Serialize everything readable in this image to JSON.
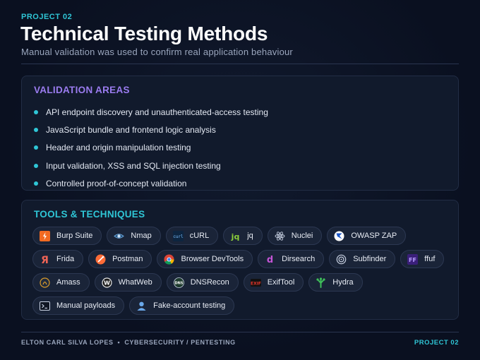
{
  "header": {
    "kicker": "PROJECT 02",
    "title": "Technical Testing Methods",
    "subtitle": "Manual validation was used to confirm real application behaviour"
  },
  "validation": {
    "heading": "VALIDATION AREAS",
    "items": [
      "API endpoint discovery and unauthenticated-access testing",
      "JavaScript bundle and frontend logic analysis",
      "Header and origin manipulation testing",
      "Input validation, XSS and SQL injection testing",
      "Controlled proof-of-concept validation"
    ]
  },
  "tools": {
    "heading": "TOOLS & TECHNIQUES",
    "items": [
      {
        "label": "Burp Suite",
        "icon": "burp-suite-icon"
      },
      {
        "label": "Nmap",
        "icon": "nmap-eye-icon"
      },
      {
        "label": "cURL",
        "icon": "curl-icon"
      },
      {
        "label": "jq",
        "icon": "jq-icon"
      },
      {
        "label": "Nuclei",
        "icon": "nuclei-atom-icon"
      },
      {
        "label": "OWASP ZAP",
        "icon": "owasp-zap-icon"
      },
      {
        "label": "Frida",
        "icon": "frida-icon"
      },
      {
        "label": "Postman",
        "icon": "postman-icon"
      },
      {
        "label": "Browser DevTools",
        "icon": "chrome-icon"
      },
      {
        "label": "Dirsearch",
        "icon": "dirsearch-icon"
      },
      {
        "label": "Subfinder",
        "icon": "subfinder-icon"
      },
      {
        "label": "ffuf",
        "icon": "ffuf-icon"
      },
      {
        "label": "Amass",
        "icon": "amass-icon"
      },
      {
        "label": "WhatWeb",
        "icon": "whatweb-icon"
      },
      {
        "label": "DNSRecon",
        "icon": "dns-icon"
      },
      {
        "label": "ExifTool",
        "icon": "exiftool-icon"
      },
      {
        "label": "Hydra",
        "icon": "hydra-icon"
      },
      {
        "label": "Manual payloads",
        "icon": "terminal-icon"
      },
      {
        "label": "Fake-account testing",
        "icon": "user-icon"
      }
    ]
  },
  "footer": {
    "author": "ELTON CARL SILVA LOPES",
    "separator": "•",
    "role": "CYBERSECURITY / PENTESTING",
    "project": "PROJECT 02"
  },
  "colors": {
    "background": "#0a1020",
    "accent_cyan": "#2fc6d6",
    "accent_purple": "#9b7cf0",
    "panel": "#111a2c"
  }
}
